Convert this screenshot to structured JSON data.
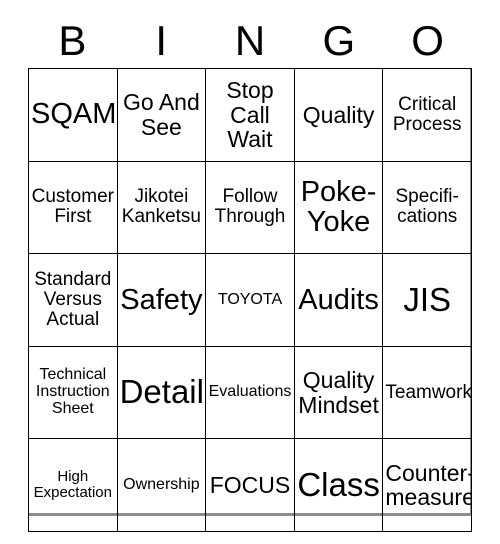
{
  "header": {
    "letters": [
      "B",
      "I",
      "N",
      "G",
      "O"
    ]
  },
  "grid": {
    "rows": [
      [
        {
          "text": "SQAM",
          "size": "fs-xl"
        },
        {
          "text": "Go And\nSee",
          "size": "fs-lg"
        },
        {
          "text": "Stop\nCall\nWait",
          "size": "fs-lg"
        },
        {
          "text": "Quality",
          "size": "fs-lg"
        },
        {
          "text": "Critical\nProcess",
          "size": "fs-md"
        }
      ],
      [
        {
          "text": "Customer\nFirst",
          "size": "fs-md"
        },
        {
          "text": "Jikotei\nKanketsu",
          "size": "fs-md"
        },
        {
          "text": "Follow\nThrough",
          "size": "fs-md"
        },
        {
          "text": "Poke-\nYoke",
          "size": "fs-xl"
        },
        {
          "text": "Specifi-\ncations",
          "size": "fs-md"
        }
      ],
      [
        {
          "text": "Standard\nVersus\nActual",
          "size": "fs-md"
        },
        {
          "text": "Safety",
          "size": "fs-xl"
        },
        {
          "text": "TOYOTA",
          "size": "fs-sm"
        },
        {
          "text": "Audits",
          "size": "fs-xl"
        },
        {
          "text": "JIS",
          "size": "fs-xxl"
        }
      ],
      [
        {
          "text": "Technical\nInstruction\nSheet",
          "size": "fs-sm"
        },
        {
          "text": "Detail",
          "size": "fs-xxl"
        },
        {
          "text": "Evaluations",
          "size": "fs-sm"
        },
        {
          "text": "Quality\nMindset",
          "size": "fs-lg"
        },
        {
          "text": "Teamwork",
          "size": "fs-md"
        }
      ],
      [
        {
          "text": "High\nExpectation",
          "size": "fs-xs"
        },
        {
          "text": "Ownership",
          "size": "fs-sm"
        },
        {
          "text": "FOCUS",
          "size": "fs-lg"
        },
        {
          "text": "Class",
          "size": "fs-xxl"
        },
        {
          "text": "Counter-\nmeasure",
          "size": "fs-lg"
        }
      ]
    ]
  },
  "colors": {
    "text": "#000000",
    "grid_line": "#000000",
    "outer_shadow": "#8c8c8c",
    "background": "#ffffff"
  }
}
